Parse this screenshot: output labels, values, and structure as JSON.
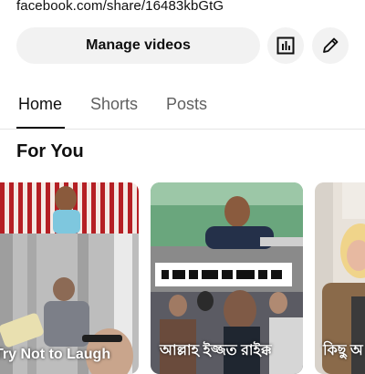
{
  "share_link": "facebook.com/share/16483kbGtG",
  "manage_button": {
    "label": "Manage videos"
  },
  "icons": {
    "analytics": "analytics-icon",
    "edit": "pencil-icon"
  },
  "tabs": [
    {
      "label": "Home",
      "active": true
    },
    {
      "label": "Shorts",
      "active": false
    },
    {
      "label": "Posts",
      "active": false
    }
  ],
  "section": {
    "title": "For You"
  },
  "shorts": [
    {
      "title": "Try Not to Laugh"
    },
    {
      "title": "আল্লাহ ইজ্জত রাইক্ক"
    },
    {
      "title": "কিছু অ"
    }
  ],
  "colors": {
    "button_bg": "#f2f2f2",
    "text_primary": "#0f0f0f",
    "text_secondary": "#606060"
  }
}
